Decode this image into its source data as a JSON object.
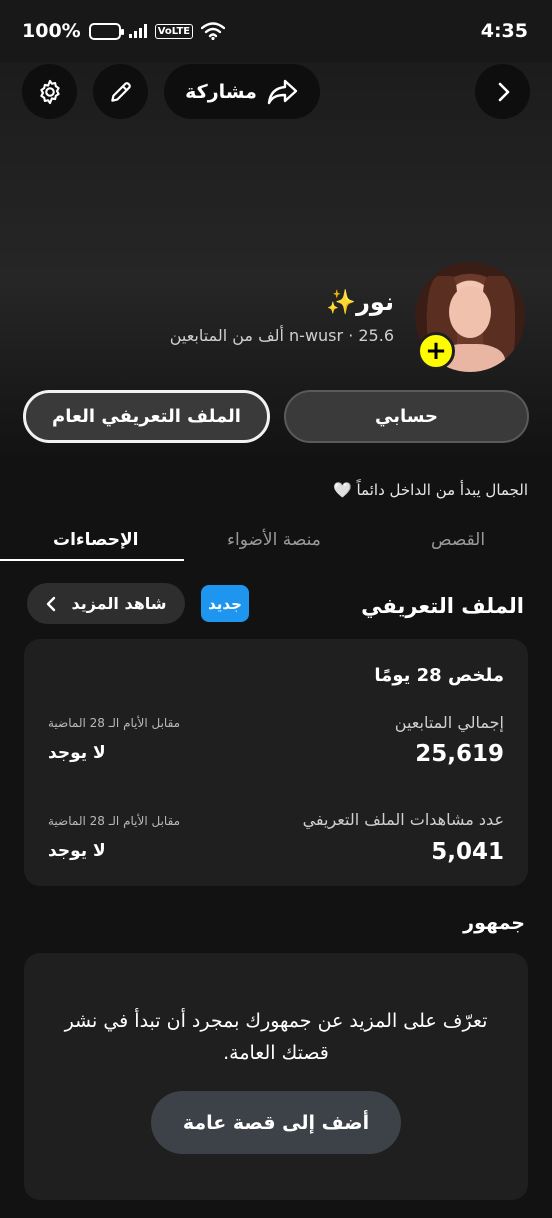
{
  "status_bar": {
    "battery": "100%",
    "volte": "VoLTE",
    "time": "4:35"
  },
  "header": {
    "share_label": "مشاركة"
  },
  "profile": {
    "name": "نور✨",
    "username": "n-wusr",
    "followers_summary": "25.6 ألف من المتابعين",
    "separator": "·",
    "add_symbol": "+"
  },
  "buttons": {
    "my_account": "حسابي",
    "public_profile": "الملف التعريفي العام"
  },
  "bio": {
    "text": "الجمال يبدأ من الداخل دائماً",
    "heart": "🤍"
  },
  "tabs": [
    {
      "label": "القصص"
    },
    {
      "label": "منصة الأضواء"
    },
    {
      "label": "الإحصاءات",
      "active": true
    }
  ],
  "profile_section": {
    "title": "الملف التعريفي",
    "new_badge": "جديد",
    "see_more": "شاهد المزيد"
  },
  "summary": {
    "title": "ملخص 28 يومًا",
    "stats": [
      {
        "label": "إجمالي المتابعين",
        "value": "25,619",
        "compare_label": "مقابل الأيام الـ 28 الماضية",
        "compare_value": "لا يوجد"
      },
      {
        "label": "عدد مشاهدات الملف التعريفي",
        "value": "5,041",
        "compare_label": "مقابل الأيام الـ 28 الماضية",
        "compare_value": "لا يوجد"
      }
    ]
  },
  "audience": {
    "title": "جمهور",
    "message": "تعرّف على المزيد عن جمهورك بمجرد أن تبدأ في نشر قصتك العامة.",
    "button": "أضف إلى قصة عامة"
  },
  "colors": {
    "accent_yellow": "#fffc00",
    "new_badge_blue": "#1e96f0"
  }
}
